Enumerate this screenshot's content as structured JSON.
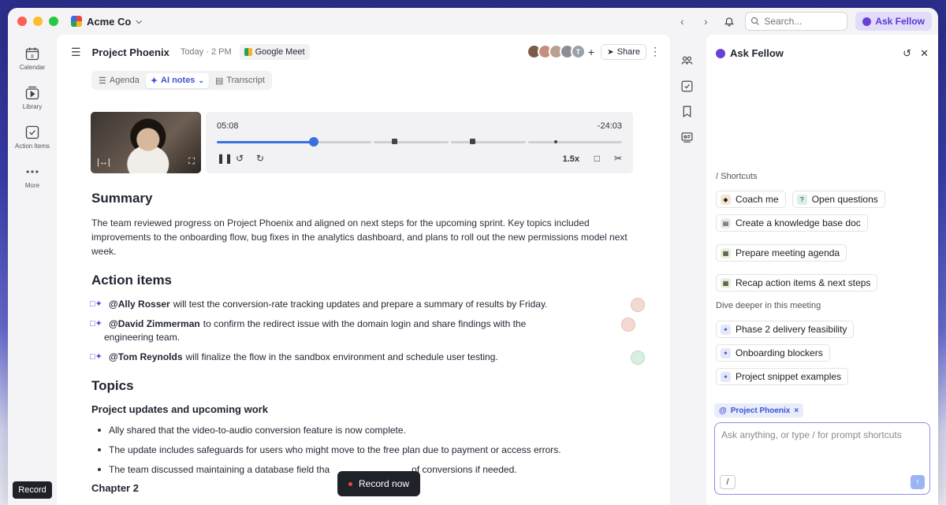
{
  "workspace": {
    "name": "Acme Co"
  },
  "topbar": {
    "search_placeholder": "Search...",
    "ask_label": "Ask Fellow"
  },
  "rail": {
    "items": [
      {
        "label": "Calendar",
        "icon": "calendar-icon"
      },
      {
        "label": "Library",
        "icon": "library-icon"
      },
      {
        "label": "Action Items",
        "icon": "checkbox-icon"
      },
      {
        "label": "More",
        "icon": "more-icon"
      }
    ],
    "record_label": "Record"
  },
  "meeting": {
    "title": "Project Phoenix",
    "time": "Today · 2 PM",
    "platform": "Google Meet",
    "share_label": "Share",
    "avatar_initial": "T",
    "tabs": [
      {
        "label": "Agenda",
        "icon": "list-icon"
      },
      {
        "label": "AI notes",
        "icon": "sparkle-icon"
      },
      {
        "label": "Transcript",
        "icon": "transcript-icon"
      }
    ]
  },
  "player": {
    "current_time": "05:08",
    "remaining": "-24:03",
    "speed": "1.5x",
    "progress": 0.24
  },
  "summary": {
    "heading": "Summary",
    "text": "The team reviewed progress on Project Phoenix and aligned on next steps for the upcoming sprint. Key topics included improvements to the onboarding flow, bug fixes in the analytics dashboard, and plans to roll out the new permissions model next week."
  },
  "action_items": {
    "heading": "Action items",
    "items": [
      {
        "who": "@Ally Rosser",
        "text": "will test the conversion-rate tracking updates and prepare a summary of results by Friday."
      },
      {
        "who": "@David Zimmerman",
        "text": "to confirm the redirect issue with the domain login and share findings with the engineering team."
      },
      {
        "who": "@Tom Reynolds",
        "text": "will finalize the flow in the sandbox environment and schedule user testing."
      }
    ]
  },
  "topics": {
    "heading": "Topics",
    "subheading": "Project updates and upcoming work",
    "bullets": [
      "Ally shared that the video-to-audio conversion feature is now complete.",
      "The update includes safeguards for users who might move to the free plan due to payment or access errors.",
      "The team discussed maintaining a database field tha",
      "of conversions if needed."
    ],
    "chapter": "Chapter 2"
  },
  "record_now": "Record now",
  "panel": {
    "title": "Ask Fellow",
    "shortcuts_label": "/ Shortcuts",
    "shortcuts": [
      {
        "label": "Coach me",
        "icon": "coach-icon",
        "color": "#f6e7d3"
      },
      {
        "label": "Open questions",
        "icon": "question-icon",
        "color": "#d8f0ea"
      },
      {
        "label": "Create a knowledge base doc",
        "icon": "doc-icon",
        "color": "#ececf2"
      },
      {
        "label": "Prepare meeting agenda",
        "icon": "calendar-icon",
        "color": "#e8f2d8"
      },
      {
        "label": "Recap action items & next steps",
        "icon": "calendar-icon",
        "color": "#e8f2d8"
      }
    ],
    "deeper_label": "Dive deeper in this meeting",
    "deeper": [
      {
        "label": "Phase 2 delivery feasibility"
      },
      {
        "label": "Onboarding blockers"
      },
      {
        "label": "Project snippet examples"
      }
    ],
    "context_chip": "Project Phoenix",
    "input_placeholder": "Ask anything, or type / for prompt shortcuts",
    "slash": "/"
  }
}
